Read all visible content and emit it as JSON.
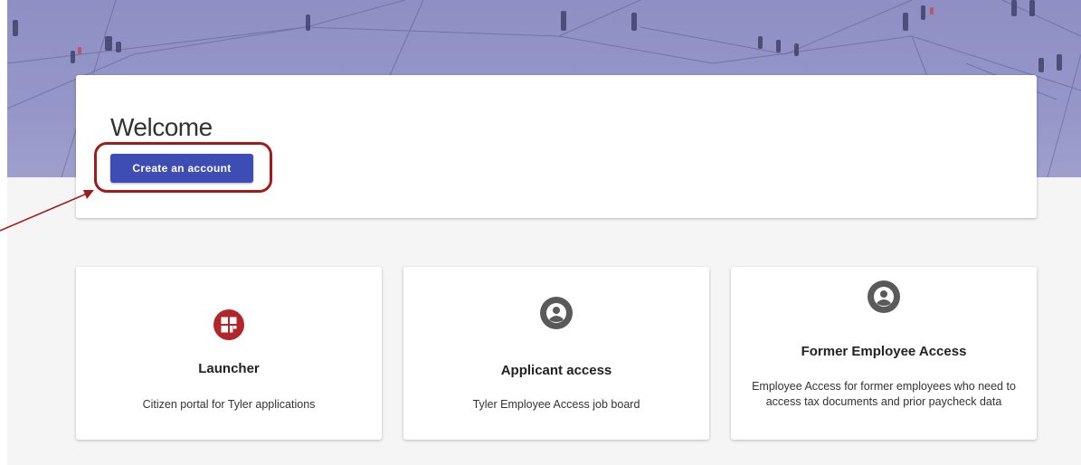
{
  "welcome": {
    "title": "Welcome",
    "create_account_label": "Create an account"
  },
  "tiles": [
    {
      "title": "Launcher",
      "description": "Citizen portal for Tyler applications",
      "icon": "launcher-grid-icon",
      "icon_color": "#b0262b"
    },
    {
      "title": "Applicant access",
      "description": "Tyler Employee Access job board",
      "icon": "user-circle-icon",
      "icon_color": "#555555"
    },
    {
      "title": "Former Employee Access",
      "description": "Employee Access for former employees who need to access tax documents and prior paycheck data",
      "icon": "user-circle-icon",
      "icon_color": "#555555"
    }
  ],
  "colors": {
    "primary_button": "#3e4db3",
    "highlight": "#a01c1c",
    "hero": "#9596c8"
  }
}
